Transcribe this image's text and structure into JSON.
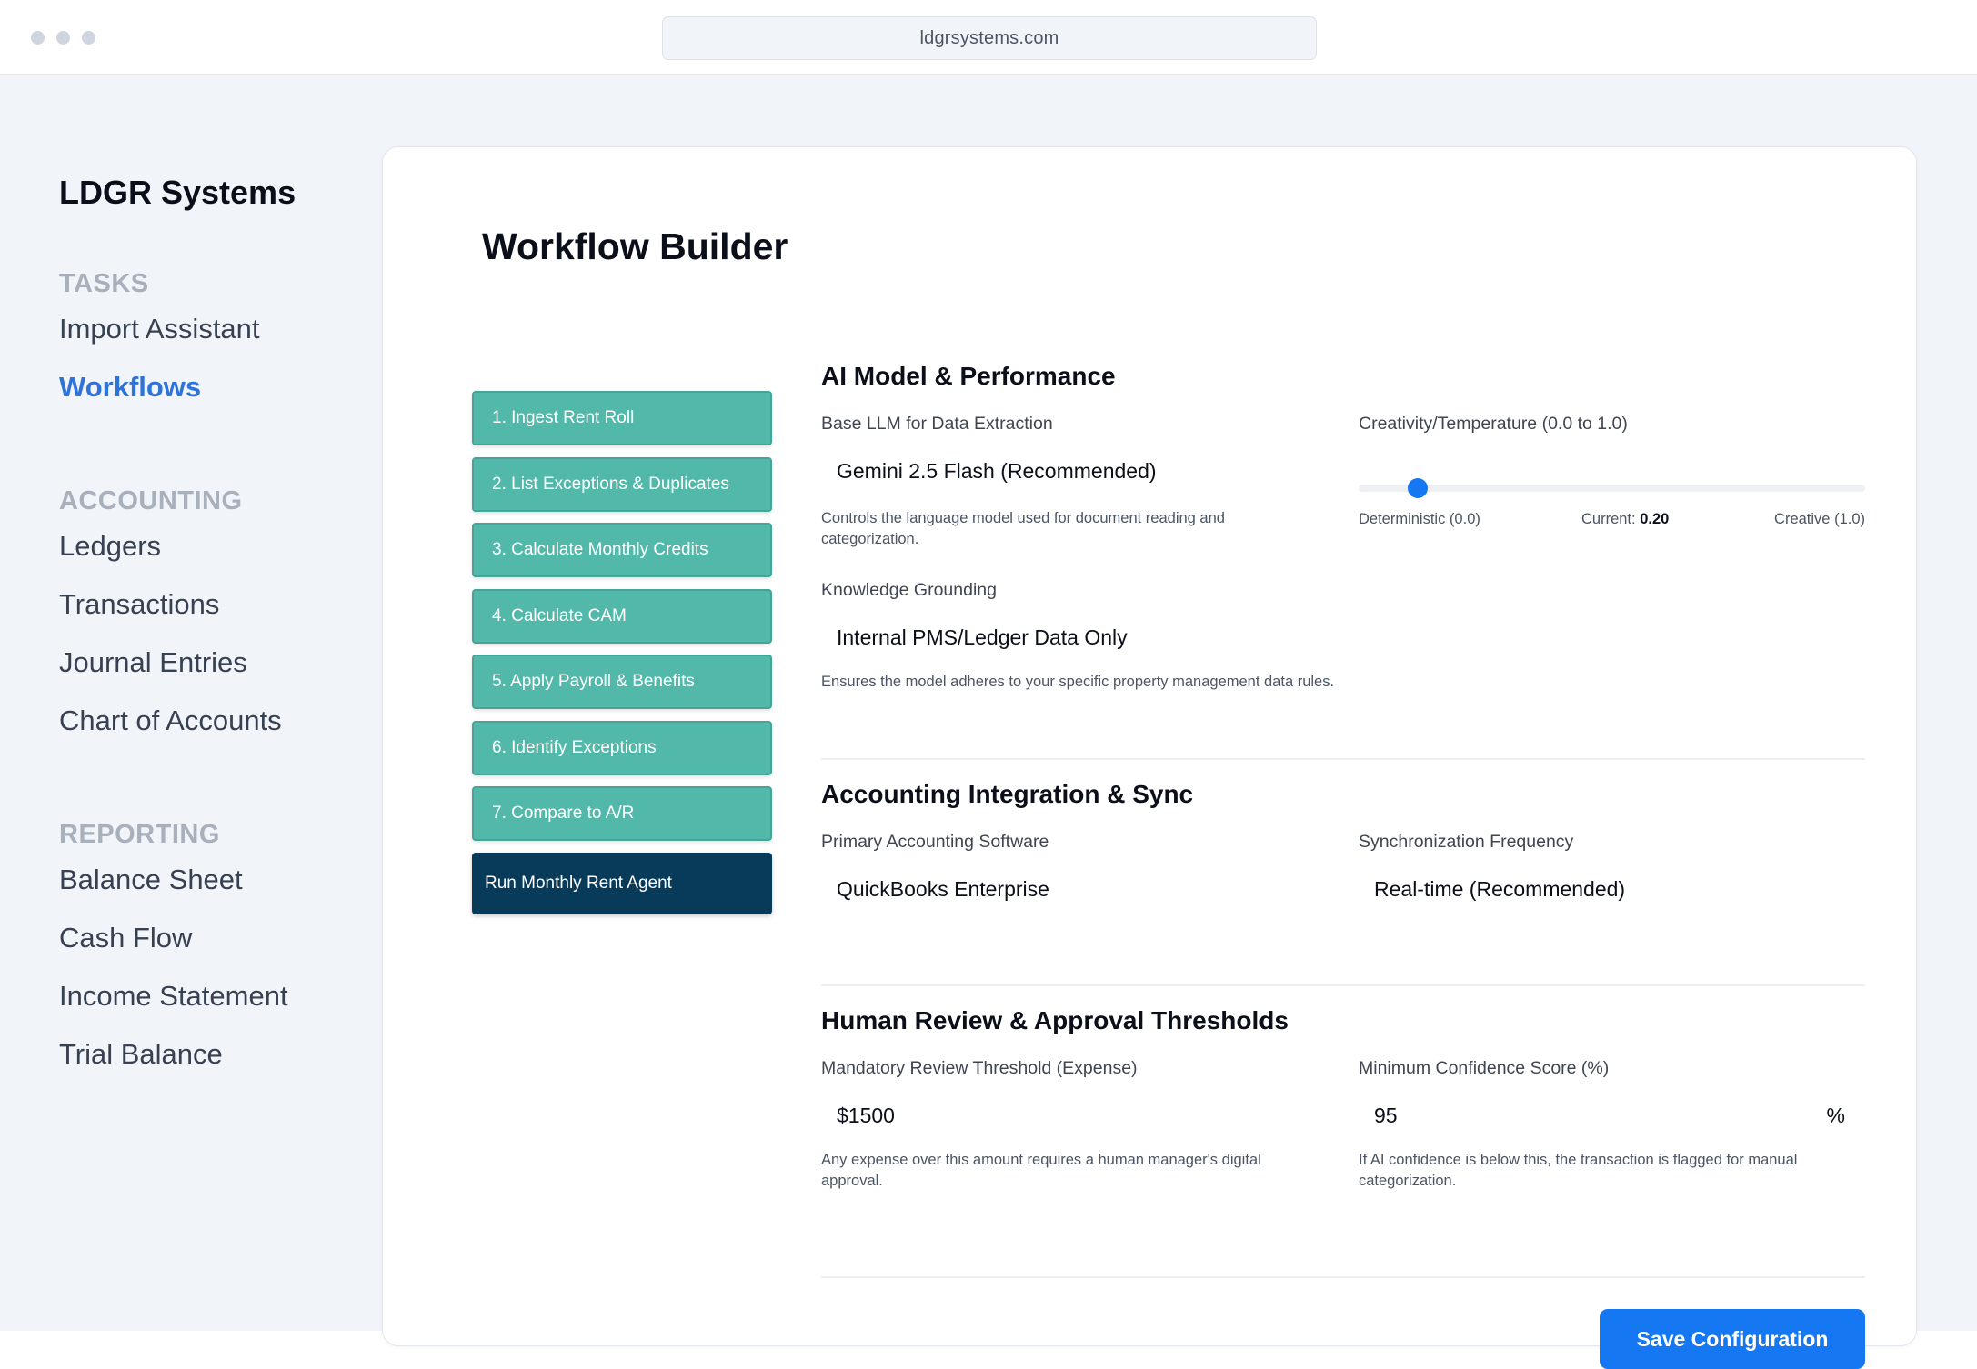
{
  "browser": {
    "url": "ldgrsystems.com"
  },
  "sidebar": {
    "brand": "LDGR Systems",
    "sections": [
      {
        "title": "TASKS",
        "items": [
          "Import Assistant",
          "Workflows"
        ]
      },
      {
        "title": "ACCOUNTING",
        "items": [
          "Ledgers",
          "Transactions",
          "Journal Entries",
          "Chart of Accounts"
        ]
      },
      {
        "title": "REPORTING",
        "items": [
          "Balance Sheet",
          "Cash Flow",
          "Income Statement",
          "Trial Balance"
        ]
      }
    ],
    "active_item": "Workflows"
  },
  "main": {
    "title": "Workflow Builder",
    "steps": [
      "1. Ingest Rent Roll",
      "2. List Exceptions & Duplicates",
      "3. Calculate Monthly Credits",
      "4. Calculate CAM",
      "5. Apply Payroll & Benefits",
      "6. Identify Exceptions",
      "7. Compare to A/R"
    ],
    "run_button": "Run Monthly Rent Agent",
    "ai_model": {
      "title": "AI Model & Performance",
      "llm_label": "Base LLM for Data Extraction",
      "llm_value": "Gemini 2.5 Flash (Recommended)",
      "llm_help": "Controls the language model used for document reading and categorization.",
      "temperature_label": "Creativity/Temperature (0.0 to 1.0)",
      "temperature_min_label": "Deterministic (0.0)",
      "temperature_current_prefix": "Current:",
      "temperature_current": "0.20",
      "temperature_value": 0.2,
      "temperature_max_label": "Creative (1.0)",
      "grounding_label": "Knowledge Grounding",
      "grounding_value": "Internal PMS/Ledger Data Only",
      "grounding_help": "Ensures the model adheres to your specific property management data rules."
    },
    "integration": {
      "title": "Accounting Integration & Sync",
      "software_label": "Primary Accounting Software",
      "software_value": "QuickBooks Enterprise",
      "frequency_label": "Synchronization Frequency",
      "frequency_value": "Real-time (Recommended)"
    },
    "review": {
      "title": "Human Review & Approval Thresholds",
      "threshold_label": "Mandatory Review Threshold (Expense)",
      "threshold_prefix": "$",
      "threshold_value": "1500",
      "threshold_help": "Any expense over this amount requires a human manager's digital approval.",
      "confidence_label": "Minimum Confidence Score (%)",
      "confidence_value": "95",
      "confidence_suffix": "%",
      "confidence_help": "If AI confidence is below this, the transaction is flagged for manual categorization."
    },
    "save_button": "Save Configuration"
  },
  "colors": {
    "accent": "#1677f2",
    "active_nav": "#2f73d9",
    "step": "#52b9aa",
    "run_button": "#083a5a"
  }
}
